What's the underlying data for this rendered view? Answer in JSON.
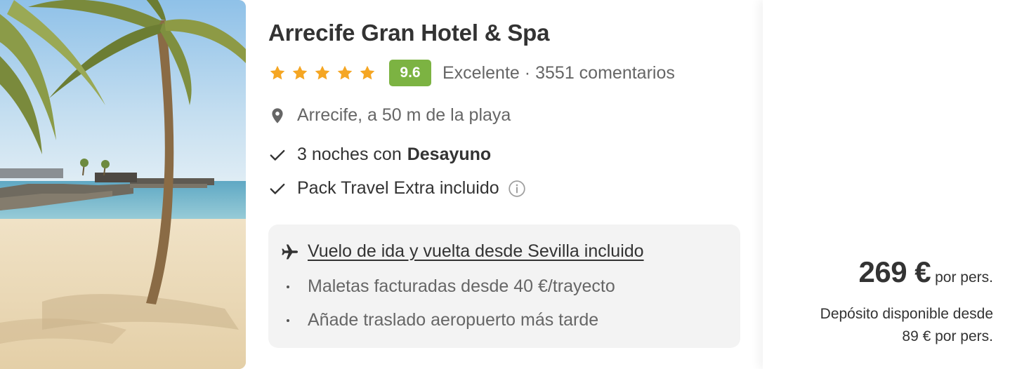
{
  "hotel": {
    "name": "Arrecife Gran Hotel & Spa",
    "stars": 5,
    "score": "9.6",
    "rating_label": "Excelente",
    "separator": "·",
    "reviews": "3551 comentarios",
    "location": "Arrecife, a 50 m de la playa"
  },
  "features": {
    "nights_prefix": "3 noches con",
    "nights_board": "Desayuno",
    "pack": "Pack Travel Extra incluido"
  },
  "flight": {
    "title": "Vuelo de ida y vuelta desde Sevilla incluido",
    "bullets": [
      "Maletas facturadas desde 40 €/trayecto",
      "Añade traslado aeropuerto más tarde"
    ]
  },
  "price": {
    "amount": "269 €",
    "per_person": "por pers.",
    "deposit_line1": "Depósito disponible desde",
    "deposit_line2": "89 € por pers."
  },
  "colors": {
    "score_badge": "#7cb342",
    "star": "#f5a623",
    "text_primary": "#333333",
    "text_secondary": "#666666",
    "flight_box_bg": "#f3f3f3"
  },
  "icons": {
    "star": "star-icon",
    "location": "location-pin-icon",
    "check": "check-icon",
    "info": "info-icon",
    "plane": "plane-icon",
    "bullet": "bullet-dot-icon"
  }
}
